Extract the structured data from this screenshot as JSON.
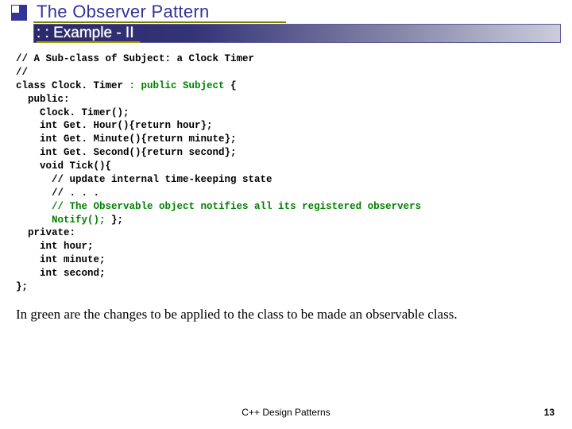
{
  "header": {
    "title": "The Observer Pattern",
    "subtitle": ": : Example - II"
  },
  "code": {
    "l01": "// A Sub-class of Subject: a Clock Timer",
    "l02": "//",
    "l03a": "class Clock. Timer ",
    "l03b": ": public Subject ",
    "l03c": "{",
    "l04": "  public:",
    "l05": "    Clock. Timer();",
    "l06": "    int Get. Hour(){return hour};",
    "l07": "    int Get. Minute(){return minute};",
    "l08": "    int Get. Second(){return second};",
    "l09": "    void Tick(){",
    "l10": "      // update internal time-keeping state",
    "l11": "      // . . .",
    "l12a": "      ",
    "l12b": "// The Observable object notifies all its registered observers",
    "l13a": "      ",
    "l13b": "Notify(); ",
    "l13c": "};",
    "l14": "  private:",
    "l15": "    int hour;",
    "l16": "    int minute;",
    "l17": "    int second;",
    "l18": "};"
  },
  "explain": "In green are the changes to be applied to the class to be made an observable class.",
  "footer": {
    "center": "C++ Design Patterns",
    "page": "13"
  }
}
